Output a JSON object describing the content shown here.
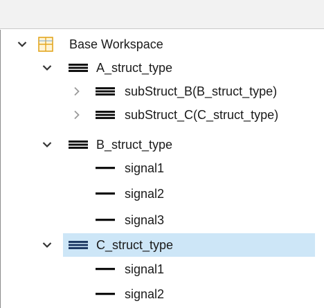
{
  "colors": {
    "header_bg": "#f2f2f2",
    "selection_bg": "#cde6f7",
    "workspace_icon_border": "#e3a621",
    "workspace_icon_fill": "#fff4d6",
    "icon_dark": "#111111",
    "icon_selected": "#1e3a64"
  },
  "tree": {
    "root": {
      "label": "Base Workspace",
      "icon": "workspace-grid-icon",
      "expanded": true
    },
    "a_struct": {
      "label": "A_struct_type",
      "icon": "struct-bus-icon",
      "expanded": true,
      "children": [
        {
          "label": "subStruct_B(B_struct_type)",
          "icon": "struct-bus-icon",
          "expanded": false
        },
        {
          "label": "subStruct_C(C_struct_type)",
          "icon": "struct-bus-icon",
          "expanded": false
        }
      ]
    },
    "b_struct": {
      "label": "B_struct_type",
      "icon": "struct-bus-icon",
      "expanded": true,
      "children": [
        {
          "label": "signal1",
          "icon": "signal-icon"
        },
        {
          "label": "signal2",
          "icon": "signal-icon"
        },
        {
          "label": "signal3",
          "icon": "signal-icon"
        }
      ]
    },
    "c_struct": {
      "label": "C_struct_type",
      "icon": "struct-bus-icon",
      "expanded": true,
      "selected": true,
      "children": [
        {
          "label": "signal1",
          "icon": "signal-icon"
        },
        {
          "label": "signal2",
          "icon": "signal-icon"
        }
      ]
    }
  }
}
